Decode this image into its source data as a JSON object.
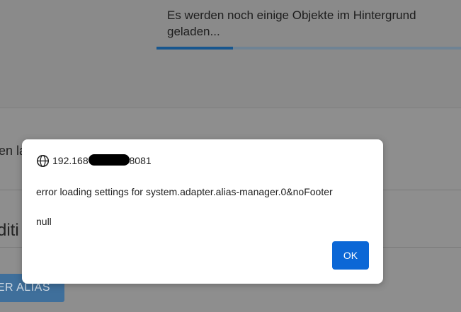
{
  "background": {
    "loading_message": "Es werden noch einige Objekte im Hintergrund geladen...",
    "loading_progress_percent": 25,
    "partial_text": "en la",
    "partial_heading": "diti",
    "alias_button_label": "ER ALIAS"
  },
  "dialog": {
    "origin_prefix": "192.168",
    "origin_suffix": ".8081",
    "message": "error loading settings for system.adapter.alias-manager.0&noFooter",
    "detail": "null",
    "ok_label": "OK"
  },
  "colors": {
    "accent": "#0b67d6",
    "progress_fill": "#17568e"
  },
  "icons": {
    "origin": "globe-icon"
  }
}
